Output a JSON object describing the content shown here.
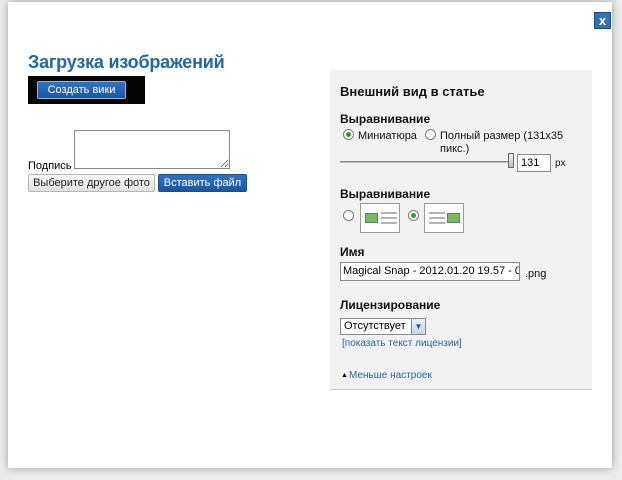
{
  "dialog": {
    "close_label": "x",
    "title": "Загрузка изображений",
    "create_wiki_label": "Создать вики",
    "caption_label": "Подпись",
    "caption_value": "",
    "choose_other_label": "Выберите другое фото",
    "insert_file_label": "Вставить файл"
  },
  "panel": {
    "title": "Внешний вид в статье",
    "size_section": "Выравнивание",
    "thumbnail_label": "Миниатюра",
    "fullsize_label": "Полный размер (131x35 пикс.)",
    "size_selected": "thumbnail",
    "width_value": "131",
    "width_unit": "px",
    "align_section": "Выравнивание",
    "align_selected": "right",
    "name_section": "Имя",
    "file_name": "Magical Snap - 2012.01.20 19.57 - 0",
    "file_ext": ".png",
    "license_section": "Лицензирование",
    "license_value": "Отсутствует",
    "show_license_link": "[показать текст лицензии]",
    "fewer_options_link": "Меньше настроек"
  },
  "icons": {
    "close": "close-icon",
    "dropdown": "chevron-down-icon",
    "collapse": "triangle-up-icon"
  },
  "colors": {
    "accent": "#2268a6",
    "button_blue": "#1f5fb0",
    "radio_checked": "#2f9b32",
    "panel_bg": "#f2f2f2"
  }
}
